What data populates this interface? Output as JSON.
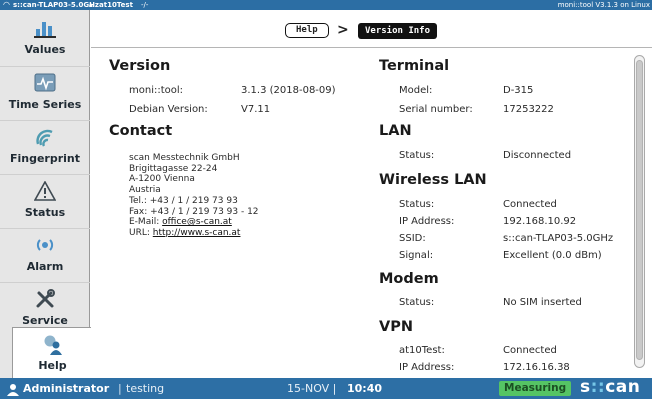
{
  "statusbar": {
    "wifi_icon": "wifi-icon",
    "ssid": "s::can-TLAP03-5.0GHz",
    "lock_icon": "lock-icon",
    "username": "at10Test",
    "network_icon": "network-icon",
    "network_symbol": "-/-",
    "app_version": "moni::tool V3.1.3 on Linux"
  },
  "sidebar": {
    "items": [
      {
        "label": "Values",
        "icon": "bar-chart-icon"
      },
      {
        "label": "Time Series",
        "icon": "time-series-icon"
      },
      {
        "label": "Fingerprint",
        "icon": "fingerprint-icon"
      },
      {
        "label": "Status",
        "icon": "warning-icon"
      },
      {
        "label": "Alarm",
        "icon": "alarm-icon"
      },
      {
        "label": "Service",
        "icon": "tools-icon"
      },
      {
        "label": "Help",
        "icon": "help-icon"
      }
    ],
    "active": "Help"
  },
  "breadcrumb": {
    "parent": "Help",
    "separator": ">",
    "current": "Version Info"
  },
  "version": {
    "title": "Version",
    "rows": [
      {
        "key": "moni::tool:",
        "value": "3.1.3 (2018-08-09)"
      },
      {
        "key": "Debian Version:",
        "value": "V7.11"
      }
    ]
  },
  "contact": {
    "title": "Contact",
    "lines": [
      "scan Messtechnik GmbH",
      "Brigittagasse 22-24",
      "A-1200 Vienna",
      "Austria",
      "Tel.: +43 / 1 / 219 73 93",
      "Fax: +43 / 1 / 219 73 93 - 12"
    ],
    "email_label": "E-Mail:",
    "email": "office@s-can.at",
    "url_label": "URL:",
    "url": "http://www.s-can.at"
  },
  "terminal": {
    "title": "Terminal",
    "rows": [
      {
        "key": "Model:",
        "value": "D-315"
      },
      {
        "key": "Serial number:",
        "value": "17253222"
      }
    ]
  },
  "lan": {
    "title": "LAN",
    "rows": [
      {
        "key": "Status:",
        "value": "Disconnected"
      }
    ]
  },
  "wlan": {
    "title": "Wireless LAN",
    "rows": [
      {
        "key": "Status:",
        "value": "Connected"
      },
      {
        "key": "IP Address:",
        "value": "192.168.10.92"
      },
      {
        "key": "SSID:",
        "value": "s::can-TLAP03-5.0GHz"
      },
      {
        "key": "Signal:",
        "value": "Excellent (0.0 dBm)"
      }
    ]
  },
  "modem": {
    "title": "Modem",
    "rows": [
      {
        "key": "Status:",
        "value": "No SIM inserted"
      }
    ]
  },
  "vpn": {
    "title": "VPN",
    "rows": [
      {
        "key": "at10Test:",
        "value": "Connected"
      },
      {
        "key": "IP Address:",
        "value": "172.16.16.38"
      }
    ]
  },
  "bottombar": {
    "user_icon": "user-icon",
    "role": "Administrator",
    "separator": "|",
    "user": "testing",
    "date": "15-NOV |",
    "time": "10:40",
    "measuring": "Measuring",
    "logo_prefix": "s",
    "logo_colons": "::",
    "logo_suffix": "can"
  },
  "colors": {
    "statusbar": "#2c6ea4",
    "bottombar": "#2d6fa5",
    "measuring_badge": "#55c464",
    "logo_accent": "#76c7e8"
  }
}
